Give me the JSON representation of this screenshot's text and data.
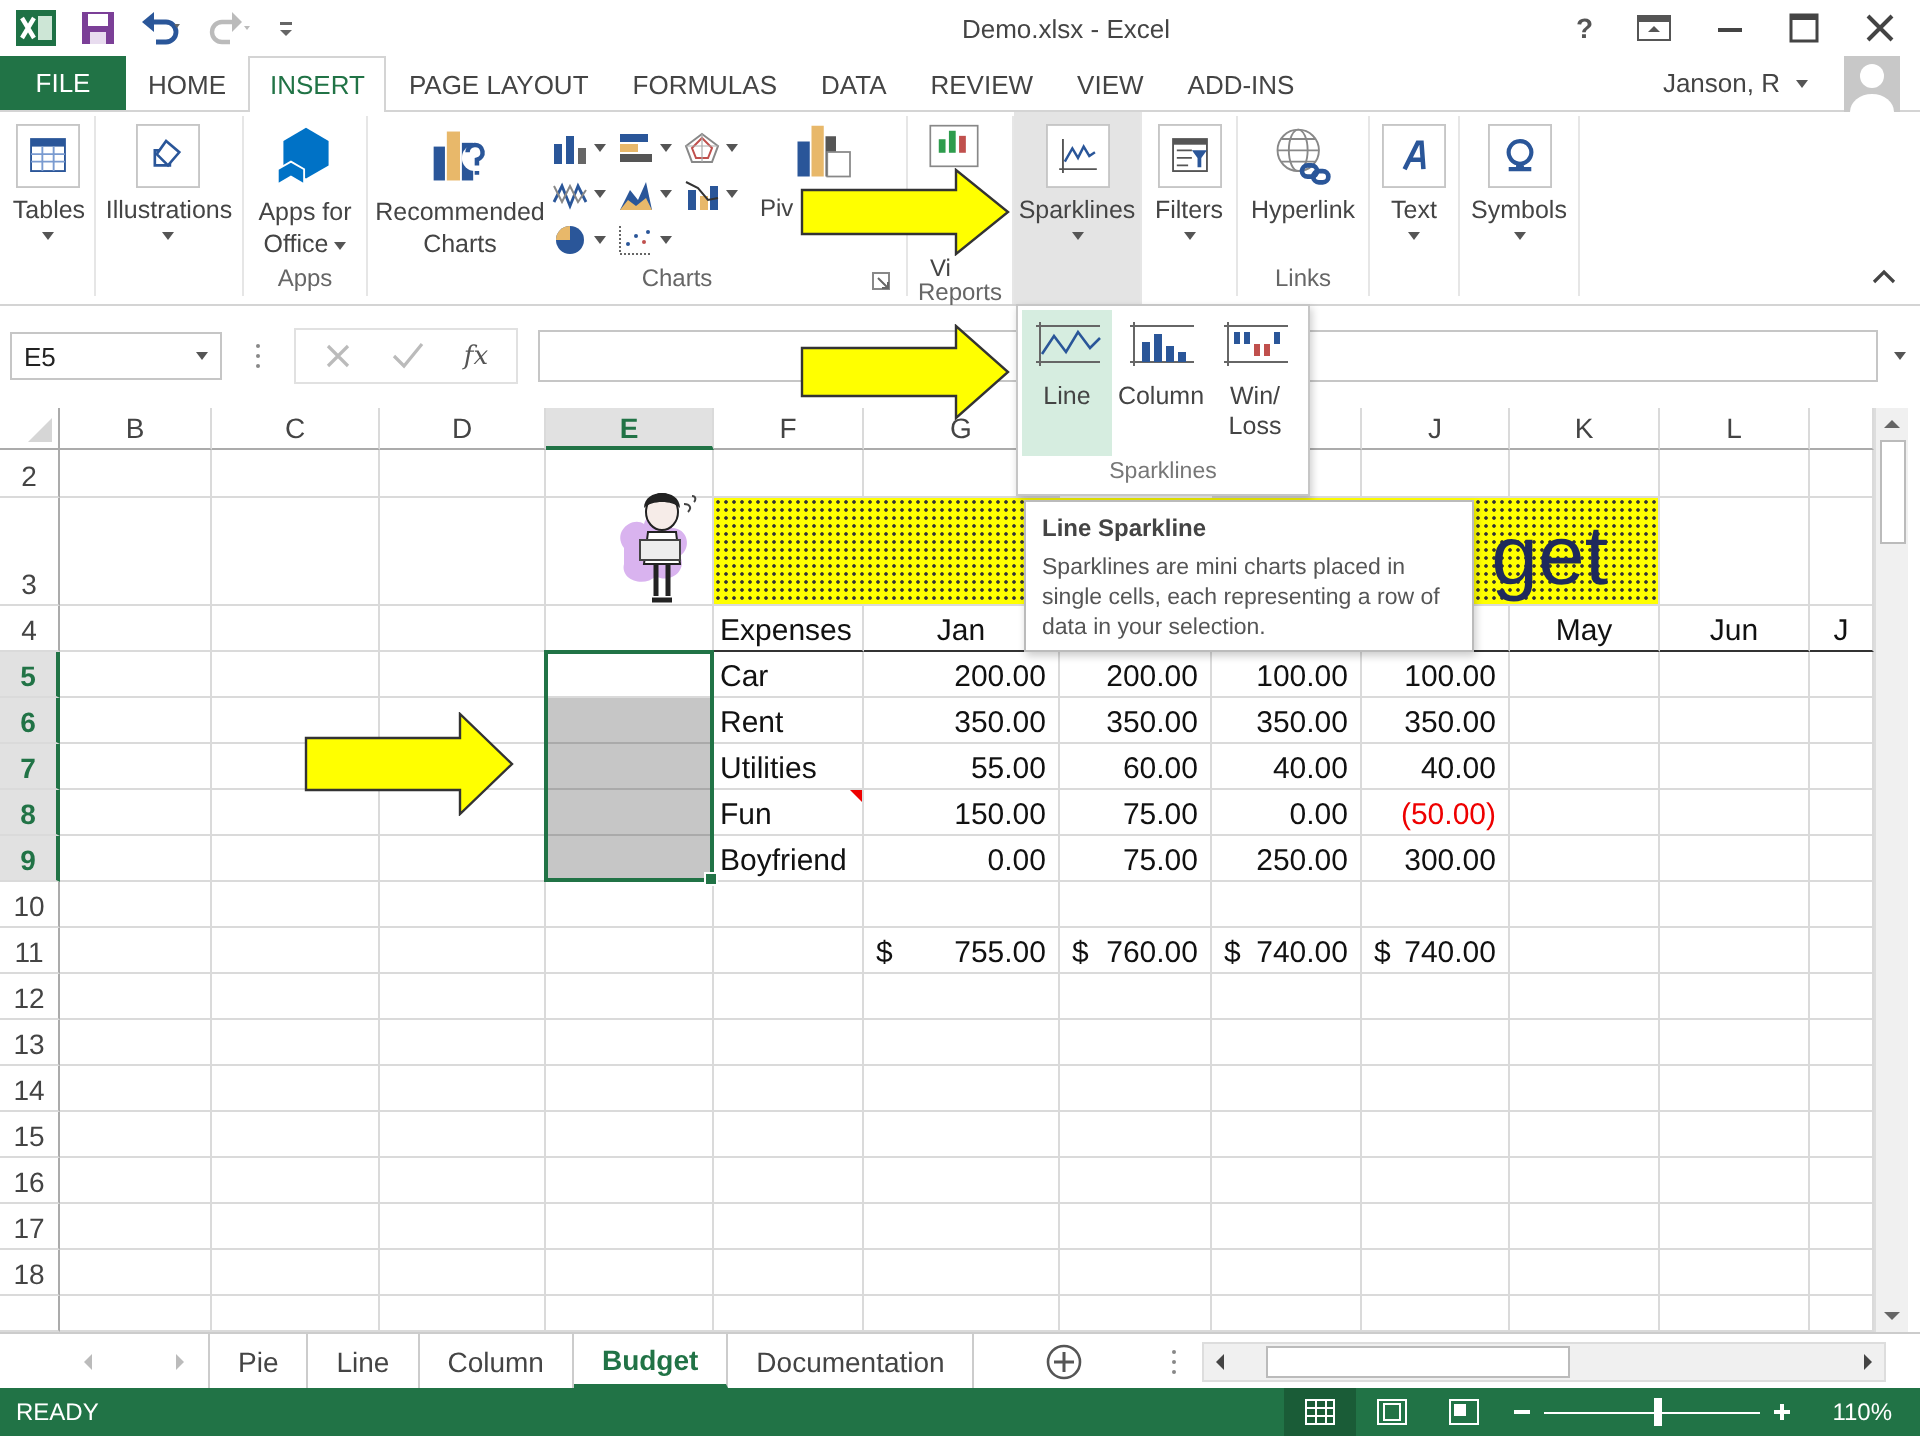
{
  "window": {
    "title": "Demo.xlsx - Excel",
    "help": "?"
  },
  "file_tab": "FILE",
  "tabs": [
    {
      "label": "HOME",
      "selected": false
    },
    {
      "label": "INSERT",
      "selected": true
    },
    {
      "label": "PAGE LAYOUT",
      "selected": false
    },
    {
      "label": "FORMULAS",
      "selected": false
    },
    {
      "label": "DATA",
      "selected": false
    },
    {
      "label": "REVIEW",
      "selected": false
    },
    {
      "label": "VIEW",
      "selected": false
    },
    {
      "label": "ADD-INS",
      "selected": false
    }
  ],
  "user": "Janson, R",
  "ribbon": {
    "tables": "Tables",
    "illustrations": "Illustrations",
    "apps_for_office": "Apps for Office",
    "apps_label": "Apps",
    "recommended_charts": "Recommended Charts",
    "pivotchart": "Piv",
    "charts_label": "Charts",
    "power_view": "Vi",
    "reports_label": "Reports",
    "sparklines": {
      "label": "Sparklines",
      "pressed": true
    },
    "filters": "Filters",
    "hyperlink": "Hyperlink",
    "links_label": "Links",
    "text": "Text",
    "symbols": "Symbols"
  },
  "sparkline_menu": {
    "items": [
      {
        "label": "Line",
        "selected": true
      },
      {
        "label": "Column",
        "selected": false
      },
      {
        "label": "Win/\nLoss",
        "selected": false
      }
    ],
    "group_label": "Sparklines"
  },
  "tooltip": {
    "title": "Line Sparkline",
    "text": "Sparklines are mini charts placed in single cells, each representing a row of data in your selection."
  },
  "formula_bar": {
    "name_box": "E5",
    "function_label": "fx"
  },
  "sheet": {
    "column_headers": [
      {
        "label": "B",
        "selected": false
      },
      {
        "label": "C",
        "selected": false
      },
      {
        "label": "D",
        "selected": false
      },
      {
        "label": "E",
        "selected": true
      },
      {
        "label": "F",
        "selected": false
      },
      {
        "label": "G",
        "selected": false
      },
      {
        "label": "J",
        "selected": false
      },
      {
        "label": "K",
        "selected": false
      },
      {
        "label": "L",
        "selected": false
      }
    ],
    "row_headers": [
      {
        "label": "2",
        "selected": false
      },
      {
        "label": "3",
        "selected": false
      },
      {
        "label": "4",
        "selected": false
      },
      {
        "label": "5",
        "selected": true
      },
      {
        "label": "6",
        "selected": true
      },
      {
        "label": "7",
        "selected": true
      },
      {
        "label": "8",
        "selected": true
      },
      {
        "label": "9",
        "selected": true
      },
      {
        "label": "10",
        "selected": false
      },
      {
        "label": "11",
        "selected": false
      },
      {
        "label": "12",
        "selected": false
      },
      {
        "label": "13",
        "selected": false
      },
      {
        "label": "14",
        "selected": false
      },
      {
        "label": "15",
        "selected": false
      },
      {
        "label": "16",
        "selected": false
      },
      {
        "label": "17",
        "selected": false
      },
      {
        "label": "18",
        "selected": false
      }
    ],
    "banner": "get",
    "table": {
      "header_left": [
        "Expenses",
        "Jan"
      ],
      "header_right": [
        "May",
        "Jun",
        "J"
      ],
      "rows": [
        {
          "category": "Car",
          "comment": false,
          "values": [
            {
              "text": "200.00",
              "negative": false
            },
            {
              "text": "200.00",
              "negative": false
            },
            {
              "text": "100.00",
              "negative": false
            },
            {
              "text": "100.00",
              "negative": false
            }
          ]
        },
        {
          "category": "Rent",
          "comment": false,
          "values": [
            {
              "text": "350.00",
              "negative": false
            },
            {
              "text": "350.00",
              "negative": false
            },
            {
              "text": "350.00",
              "negative": false
            },
            {
              "text": "350.00",
              "negative": false
            }
          ]
        },
        {
          "category": "Utilities",
          "comment": false,
          "values": [
            {
              "text": "55.00",
              "negative": false
            },
            {
              "text": "60.00",
              "negative": false
            },
            {
              "text": "40.00",
              "negative": false
            },
            {
              "text": "40.00",
              "negative": false
            }
          ]
        },
        {
          "category": "Fun",
          "comment": true,
          "values": [
            {
              "text": "150.00",
              "negative": false
            },
            {
              "text": "75.00",
              "negative": false
            },
            {
              "text": "0.00",
              "negative": false
            },
            {
              "text": "(50.00)",
              "negative": true
            }
          ]
        },
        {
          "category": "Boyfriend",
          "comment": false,
          "values": [
            {
              "text": "0.00",
              "negative": false
            },
            {
              "text": "75.00",
              "negative": false
            },
            {
              "text": "250.00",
              "negative": false
            },
            {
              "text": "300.00",
              "negative": false
            }
          ]
        }
      ],
      "totals": [
        {
          "currency": "$",
          "amount": "755.00"
        },
        {
          "currency": "$",
          "amount": "760.00"
        },
        {
          "currency": "$",
          "amount": "740.00"
        },
        {
          "currency": "$",
          "amount": "740.00"
        }
      ]
    }
  },
  "sheet_tabs": [
    {
      "label": "Pie",
      "selected": false
    },
    {
      "label": "Line",
      "selected": false
    },
    {
      "label": "Column",
      "selected": false
    },
    {
      "label": "Budget",
      "selected": true
    },
    {
      "label": "Documentation",
      "selected": false
    }
  ],
  "status_bar": {
    "status": "READY",
    "view_buttons": [
      {
        "selected": true
      },
      {
        "selected": false
      },
      {
        "selected": false
      }
    ],
    "zoom_slider": {
      "level": 0.53
    },
    "zoom": "110%"
  }
}
